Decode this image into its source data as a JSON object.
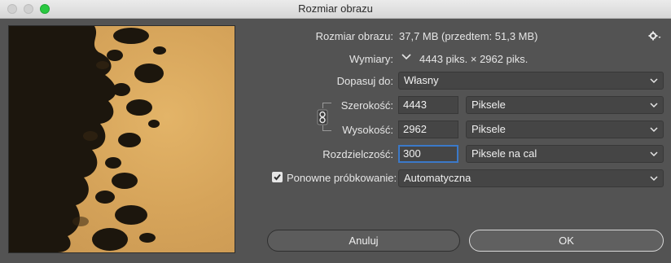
{
  "window": {
    "title": "Rozmiar obrazu"
  },
  "info": {
    "image_size_label": "Rozmiar obrazu:",
    "image_size_value": "37,7 MB (przedtem: 51,3 MB)",
    "dimensions_label": "Wymiary:",
    "dimensions_value": "4443 piks. × 2962 piks."
  },
  "fit_to": {
    "label": "Dopasuj do:",
    "value": "Własny"
  },
  "width": {
    "label": "Szerokość:",
    "value": "4443",
    "unit": "Piksele"
  },
  "height": {
    "label": "Wysokość:",
    "value": "2962",
    "unit": "Piksele"
  },
  "resolution": {
    "label": "Rozdzielczość:",
    "value": "300",
    "unit": "Piksele na cal"
  },
  "resample": {
    "label": "Ponowne próbkowanie:",
    "checked": true,
    "value": "Automatyczna"
  },
  "buttons": {
    "cancel": "Anuluj",
    "ok": "OK"
  },
  "icons": {
    "gear": "gear-icon",
    "chain": "chain-link-icon",
    "chevron": "chevron-down-icon",
    "checkmark": "checkmark-icon"
  },
  "colors": {
    "focus": "#3b79c9",
    "close_light": "#2ac941"
  }
}
